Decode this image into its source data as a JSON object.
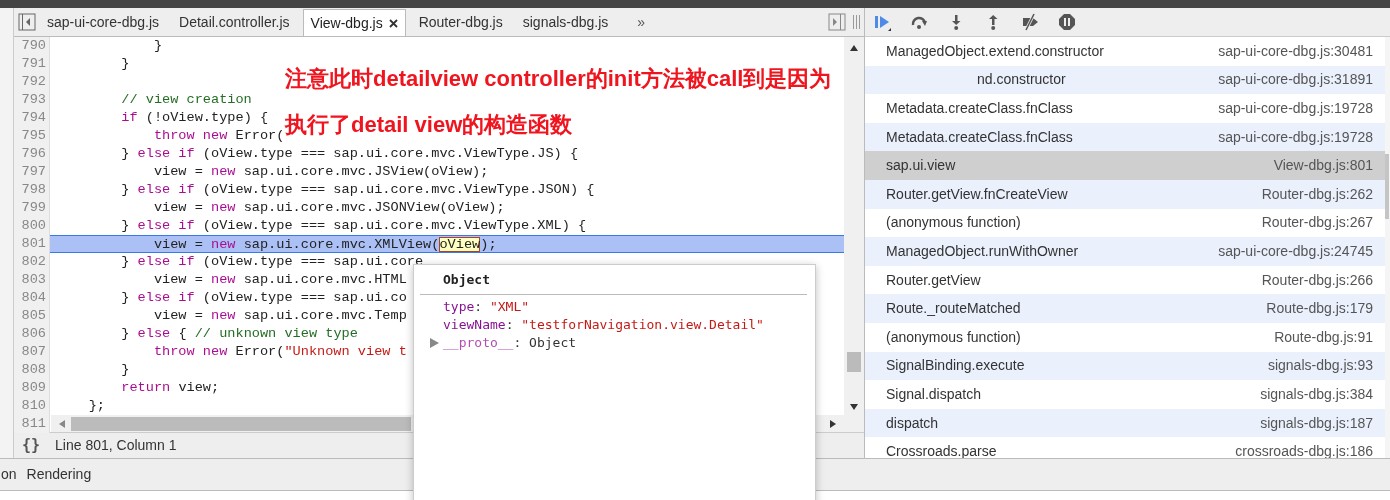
{
  "editor": {
    "tabs": [
      {
        "label": "sap-ui-core-dbg.js",
        "selected": false,
        "closable": false
      },
      {
        "label": "Detail.controller.js",
        "selected": false,
        "closable": false
      },
      {
        "label": "View-dbg.js",
        "selected": true,
        "closable": true
      },
      {
        "label": "Router-dbg.js",
        "selected": false,
        "closable": false
      },
      {
        "label": "signals-dbg.js",
        "selected": false,
        "closable": false
      }
    ],
    "overflow": "»",
    "lines": [
      {
        "number": "790",
        "selected": false,
        "tokens": [
          {
            "kind": "plain",
            "text": "            }"
          }
        ]
      },
      {
        "number": "791",
        "selected": false,
        "tokens": [
          {
            "kind": "plain",
            "text": "        }"
          }
        ]
      },
      {
        "number": "792",
        "selected": false
      },
      {
        "number": "793",
        "selected": false,
        "tokens": [
          {
            "kind": "comment",
            "text": "        // view creation"
          }
        ]
      },
      {
        "number": "794",
        "selected": false,
        "tokens": [
          {
            "kind": "keyword",
            "text": "        if"
          },
          {
            "kind": "plain",
            "text": " (!oView.type) {"
          }
        ]
      },
      {
        "number": "795",
        "selected": false,
        "tokens": [
          {
            "kind": "keyword",
            "text": "            throw new"
          },
          {
            "kind": "plain",
            "text": " Error("
          }
        ]
      },
      {
        "number": "796",
        "selected": false,
        "tokens": [
          {
            "kind": "plain",
            "text": "        } "
          },
          {
            "kind": "keyword",
            "text": "else if"
          },
          {
            "kind": "plain",
            "text": " (oView.type === sap.ui.core.mvc.ViewType.JS) {"
          }
        ]
      },
      {
        "number": "797",
        "selected": false,
        "tokens": [
          {
            "kind": "plain",
            "text": "            view = "
          },
          {
            "kind": "keyword",
            "text": "new"
          },
          {
            "kind": "plain",
            "text": " sap.ui.core.mvc.JSView(oView);"
          }
        ]
      },
      {
        "number": "798",
        "selected": false,
        "tokens": [
          {
            "kind": "plain",
            "text": "        } "
          },
          {
            "kind": "keyword",
            "text": "else if"
          },
          {
            "kind": "plain",
            "text": " (oView.type === sap.ui.core.mvc.ViewType.JSON) {"
          }
        ]
      },
      {
        "number": "799",
        "selected": false,
        "tokens": [
          {
            "kind": "plain",
            "text": "            view = "
          },
          {
            "kind": "keyword",
            "text": "new"
          },
          {
            "kind": "plain",
            "text": " sap.ui.core.mvc.JSONView(oView);"
          }
        ]
      },
      {
        "number": "800",
        "selected": false,
        "tokens": [
          {
            "kind": "plain",
            "text": "        } "
          },
          {
            "kind": "keyword",
            "text": "else if"
          },
          {
            "kind": "plain",
            "text": " (oView.type === sap.ui.core.mvc.ViewType.XML) {"
          }
        ]
      },
      {
        "number": "801",
        "selected": true,
        "tokens": [
          {
            "kind": "plain",
            "text": "            view = "
          },
          {
            "kind": "keyword",
            "text": "new"
          },
          {
            "kind": "plain",
            "text": " sap.ui.core.mvc.XMLView("
          },
          {
            "kind": "hovered",
            "text": "oView"
          },
          {
            "kind": "plain",
            "text": ");"
          }
        ]
      },
      {
        "number": "802",
        "selected": false,
        "tokens": [
          {
            "kind": "plain",
            "text": "        } "
          },
          {
            "kind": "keyword",
            "text": "else if"
          },
          {
            "kind": "plain",
            "text": " (oView.type === sap.ui.core"
          }
        ]
      },
      {
        "number": "803",
        "selected": false,
        "tokens": [
          {
            "kind": "plain",
            "text": "            view = "
          },
          {
            "kind": "keyword",
            "text": "new"
          },
          {
            "kind": "plain",
            "text": " sap.ui.core.mvc.HTML"
          }
        ]
      },
      {
        "number": "804",
        "selected": false,
        "tokens": [
          {
            "kind": "plain",
            "text": "        } "
          },
          {
            "kind": "keyword",
            "text": "else if"
          },
          {
            "kind": "plain",
            "text": " (oView.type === sap.ui.co"
          }
        ]
      },
      {
        "number": "805",
        "selected": false,
        "tokens": [
          {
            "kind": "plain",
            "text": "            view = "
          },
          {
            "kind": "keyword",
            "text": "new"
          },
          {
            "kind": "plain",
            "text": " sap.ui.core.mvc.Temp"
          }
        ]
      },
      {
        "number": "806",
        "selected": false,
        "tokens": [
          {
            "kind": "plain",
            "text": "        } "
          },
          {
            "kind": "keyword",
            "text": "else"
          },
          {
            "kind": "plain",
            "text": " { "
          },
          {
            "kind": "comment",
            "text": "// unknown view type"
          }
        ]
      },
      {
        "number": "807",
        "selected": false,
        "tokens": [
          {
            "kind": "keyword",
            "text": "            throw new"
          },
          {
            "kind": "plain",
            "text": " Error("
          },
          {
            "kind": "string",
            "text": "\"Unknown view t"
          }
        ]
      },
      {
        "number": "808",
        "selected": false,
        "tokens": [
          {
            "kind": "plain",
            "text": "        }"
          }
        ]
      },
      {
        "number": "809",
        "selected": false,
        "tokens": [
          {
            "kind": "keyword",
            "text": "        return"
          },
          {
            "kind": "plain",
            "text": " view;"
          }
        ]
      },
      {
        "number": "810",
        "selected": false,
        "tokens": [
          {
            "kind": "plain",
            "text": "    };"
          }
        ]
      },
      {
        "number": "811",
        "selected": false
      }
    ],
    "pretty_print": "{}",
    "status": "Line 801, Column 1"
  },
  "annotation": [
    "注意此时detailview controller的init方法被call到是因为",
    "执行了detail view的构造函数"
  ],
  "popover": {
    "title": "Object",
    "properties": [
      {
        "kind": "value",
        "key": "type",
        "separator": ":",
        "value": "\"XML\""
      },
      {
        "kind": "value",
        "key": "viewName",
        "separator": ":",
        "value": "\"testforNavigation.view.Detail\""
      },
      {
        "kind": "expandable",
        "key": "__proto__",
        "separator": ":",
        "value": "Object"
      }
    ]
  },
  "call_stack": [
    {
      "function": "ManagedObject.extend.constructor",
      "location": "sap-ui-core-dbg.js:30481",
      "selected": false,
      "partial": false
    },
    {
      "function": "nd.constructor",
      "location": "sap-ui-core-dbg.js:31891",
      "selected": false,
      "partial": true
    },
    {
      "function": "Metadata.createClass.fnClass",
      "location": "sap-ui-core-dbg.js:19728",
      "selected": false,
      "partial": false
    },
    {
      "function": "Metadata.createClass.fnClass",
      "location": "sap-ui-core-dbg.js:19728",
      "selected": false,
      "partial": false
    },
    {
      "function": "sap.ui.view",
      "location": "View-dbg.js:801",
      "selected": true,
      "partial": false
    },
    {
      "function": "Router.getView.fnCreateView",
      "location": "Router-dbg.js:262",
      "selected": false,
      "partial": false
    },
    {
      "function": "(anonymous function)",
      "location": "Router-dbg.js:267",
      "selected": false,
      "partial": false
    },
    {
      "function": "ManagedObject.runWithOwner",
      "location": "sap-ui-core-dbg.js:24745",
      "selected": false,
      "partial": false
    },
    {
      "function": "Router.getView",
      "location": "Router-dbg.js:266",
      "selected": false,
      "partial": false
    },
    {
      "function": "Route._routeMatched",
      "location": "Route-dbg.js:179",
      "selected": false,
      "partial": false
    },
    {
      "function": "(anonymous function)",
      "location": "Route-dbg.js:91",
      "selected": false,
      "partial": false
    },
    {
      "function": "SignalBinding.execute",
      "location": "signals-dbg.js:93",
      "selected": false,
      "partial": false
    },
    {
      "function": "Signal.dispatch",
      "location": "signals-dbg.js:384",
      "selected": false,
      "partial": false
    },
    {
      "function": "dispatch",
      "location": "signals-dbg.js:187",
      "selected": false,
      "partial": false
    },
    {
      "function": "Crossroads.parse",
      "location": "crossroads-dbg.js:186",
      "selected": false,
      "partial": false
    }
  ],
  "drawer_tabs": [
    {
      "label": "on",
      "selected": false
    },
    {
      "label": "Rendering",
      "selected": false
    }
  ]
}
